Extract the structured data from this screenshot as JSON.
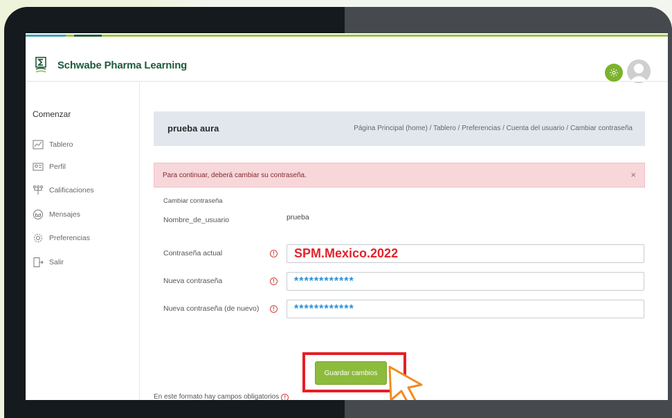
{
  "app": {
    "brand": "Schwabe Pharma Learning",
    "accent_color": "#9ac43c",
    "brand_color": "#1e5a3a"
  },
  "header": {
    "settings_icon": "gear-icon",
    "avatar_icon": "user-avatar-icon"
  },
  "sidebar": {
    "title": "Comenzar",
    "items": [
      {
        "label": "Tablero",
        "icon": "dashboard-icon"
      },
      {
        "label": "Perfil",
        "icon": "profile-card-icon"
      },
      {
        "label": "Calificaciones",
        "icon": "grades-tree-icon"
      },
      {
        "label": "Mensajes",
        "icon": "messages-icon"
      },
      {
        "label": "Preferencias",
        "icon": "gear-icon"
      },
      {
        "label": "Salir",
        "icon": "exit-door-icon"
      }
    ]
  },
  "page": {
    "user_name": "prueba aura",
    "breadcrumb": "Página Principal (home) / Tablero / Preferencias / Cuenta del usuario / Cambiar contraseña"
  },
  "alert": {
    "message": "Para continuar, deberá cambiar su contraseña.",
    "close": "×"
  },
  "form": {
    "section_title": "Cambiar contraseña",
    "username_label": "Nombre_de_usuario",
    "username_value": "prueba",
    "current_label": "Contraseña actual",
    "current_value": "SPM.Mexico.2022",
    "new_label": "Nueva contraseña",
    "new_value": "************",
    "confirm_label": "Nueva contraseña (de nuevo)",
    "confirm_value": "************",
    "required_mark": "!",
    "save_label": "Guardar cambios",
    "required_note": "En este formato hay campos obligatorios"
  }
}
